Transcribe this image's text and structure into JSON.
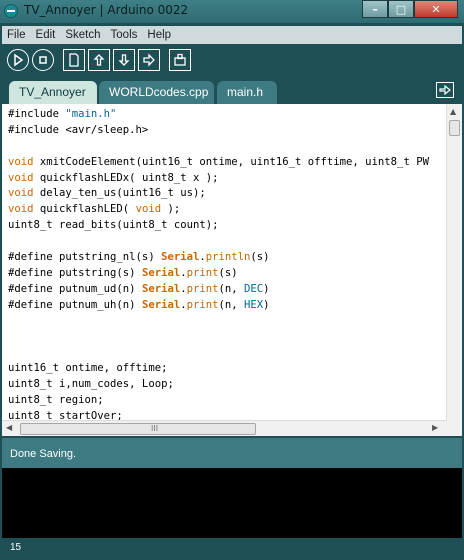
{
  "window": {
    "title": "TV_Annoyer | Arduino 0022",
    "min": "–",
    "max": "□",
    "close": "✕"
  },
  "menu": [
    "File",
    "Edit",
    "Sketch",
    "Tools",
    "Help"
  ],
  "toolbar": [
    "verify-icon",
    "stop-icon",
    "new-icon",
    "open-icon",
    "save-icon",
    "upload-icon",
    "serial-monitor-icon"
  ],
  "tabs": [
    {
      "label": "TV_Annoyer",
      "active": true
    },
    {
      "label": "WORLDcodes.cpp",
      "active": false
    },
    {
      "label": "main.h",
      "active": false
    }
  ],
  "editor": {
    "lines": [
      "#include \"main.h\"",
      "#include <avr/sleep.h>",
      "",
      "void xmitCodeElement(uint16_t ontime, uint16_t offtime, uint8_t PW",
      "void quickflashLEDx( uint8_t x );",
      "void delay_ten_us(uint16_t us);",
      "void quickflashLED( void );",
      "uint8_t read_bits(uint8_t count);",
      "",
      "#define putstring_nl(s) Serial.println(s)",
      "#define putstring(s) Serial.print(s)",
      "#define putnum_ud(n) Serial.print(n, DEC)",
      "#define putnum_uh(n) Serial.print(n, HEX)",
      "",
      "",
      "",
      "uint16_t ontime, offtime;",
      "uint8_t i,num_codes, Loop;",
      "uint8_t region;",
      "uint8_t startOver;"
    ],
    "hscroll_grip": "III"
  },
  "status": {
    "message": "Done Saving."
  },
  "footer": {
    "line_number": "15"
  }
}
